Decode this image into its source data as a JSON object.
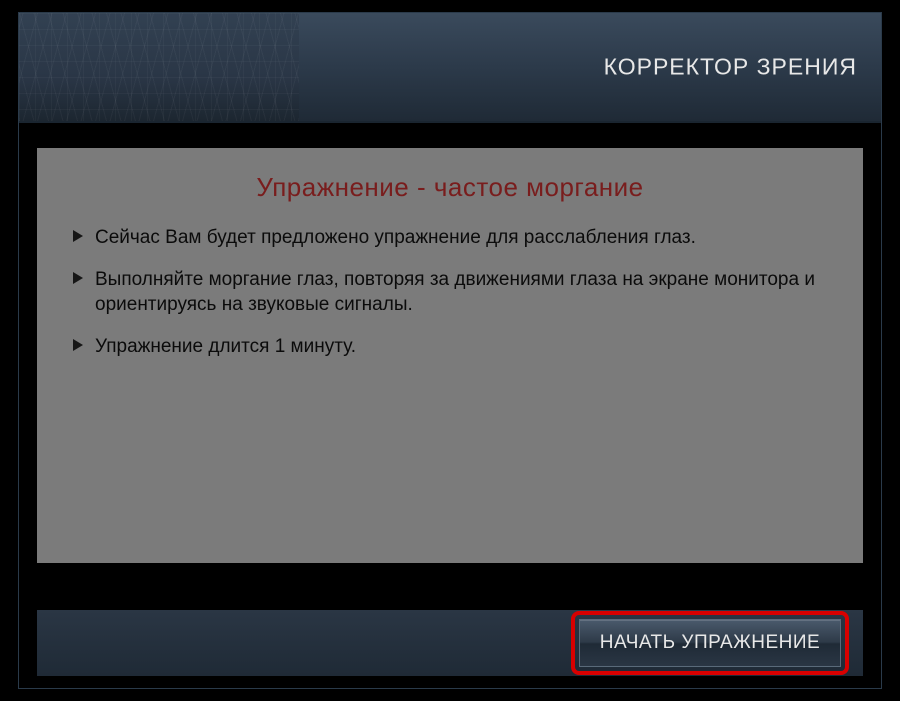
{
  "header": {
    "title": "КОРРЕКТОР ЗРЕНИЯ"
  },
  "content": {
    "title": "Упражнение - частое моргание",
    "instructions": [
      "Сейчас Вам будет предложено упражнение для расслабления глаз.",
      "Выполняйте моргание глаз, повторяя за движениями глаза на экране монитора и ориентируясь на звуковые сигналы.",
      "Упражнение длится 1 минуту."
    ]
  },
  "footer": {
    "start_button_label": "НАЧАТЬ УПРАЖНЕНИЕ"
  },
  "colors": {
    "accent_red": "#d80000",
    "title_red": "#8a2222",
    "header_gradient_top": "#3a4a5c",
    "header_gradient_bottom": "#1f2a36"
  }
}
